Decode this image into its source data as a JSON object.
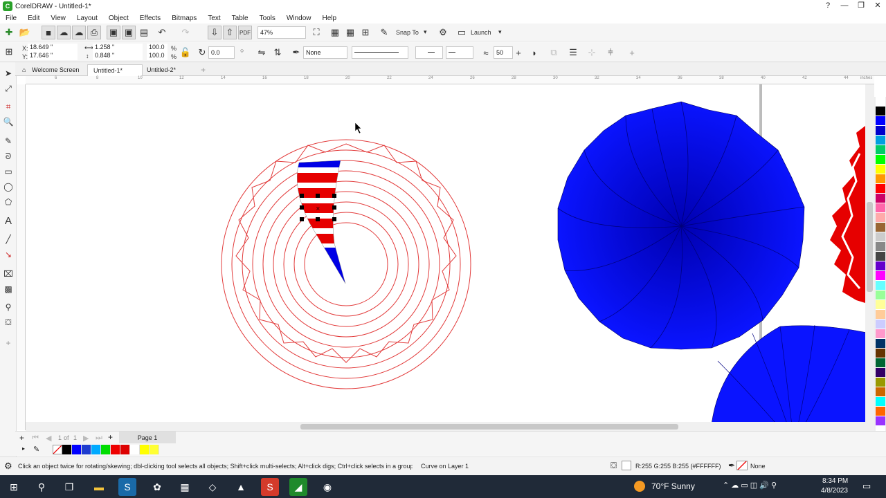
{
  "app": {
    "window_title": "CorelDRAW - Untitled-1*",
    "logo_glyph": "C"
  },
  "window_buttons": {
    "help": "?",
    "minimize": "—",
    "restore": "❐",
    "close": "✕"
  },
  "menu": [
    "File",
    "Edit",
    "View",
    "Layout",
    "Object",
    "Effects",
    "Bitmaps",
    "Text",
    "Table",
    "Tools",
    "Window",
    "Help"
  ],
  "toolbar": {
    "zoom_value": "47%",
    "snap_label": "Snap To",
    "launch_label": "Launch"
  },
  "properties": {
    "x_label": "X:",
    "x_value": "18.649 \"",
    "y_label": "Y:",
    "y_value": "17.646 \"",
    "w_value": "1.258 \"",
    "h_value": "0.848 \"",
    "scale_w": "100.0",
    "scale_h": "100.0",
    "percent": "%",
    "rotation": "0.0",
    "fill_none": "None",
    "count_value": "50"
  },
  "tabs": [
    "Welcome Screen",
    "Untitled-1*",
    "Untitled-2*"
  ],
  "ruler": {
    "ticks": [
      "6",
      "8",
      "10",
      "12",
      "14",
      "16",
      "18",
      "20",
      "22",
      "24",
      "26",
      "28",
      "30",
      "32",
      "34",
      "36",
      "38",
      "40",
      "42",
      "44"
    ],
    "unit": "inches"
  },
  "page_nav": {
    "current": "1",
    "of": "of",
    "total": "1",
    "page_tab": "Page 1"
  },
  "status": {
    "hint": "Click an object twice for rotating/skewing; dbl-clicking tool selects all objects; Shift+click multi-selects; Alt+click digs; Ctrl+click selects in a group",
    "object_info": "Curve on Layer 1",
    "fill_color": "R:255 G:255 B:255 (#FFFFFF)",
    "outline": "None"
  },
  "taskbar": {
    "weather": "70°F  Sunny",
    "time": "8:34 PM",
    "date": "4/8/2023"
  },
  "palette_colors": [
    "#ffffff",
    "#000000",
    "#0000ff",
    "#0000cc",
    "#00a0e0",
    "#00cc66",
    "#00ff00",
    "#ffff00",
    "#ff9900",
    "#ff0000",
    "#cc0066",
    "#ff66aa",
    "#ffaaaa",
    "#996633",
    "#cccccc",
    "#888888",
    "#444444",
    "#6600cc",
    "#ff00ff",
    "#66ffff",
    "#99ff99",
    "#ffff99",
    "#ffcc99",
    "#ccccff",
    "#ff99cc",
    "#003366",
    "#663300",
    "#006633",
    "#330066",
    "#999900",
    "#cc6600",
    "#00ffff",
    "#ff6600",
    "#9933ff",
    "#ffffff"
  ],
  "doc_palette": [
    "#000000",
    "#0000ff",
    "#1e3ccf",
    "#00aaff",
    "#00dd00",
    "#ee0000",
    "#dd0000",
    "#ffffff",
    "#ffff00",
    "#ffff33"
  ],
  "colors": {
    "blue": "#0000e6",
    "red": "#e60000",
    "outline_red": "#e23a3a"
  }
}
